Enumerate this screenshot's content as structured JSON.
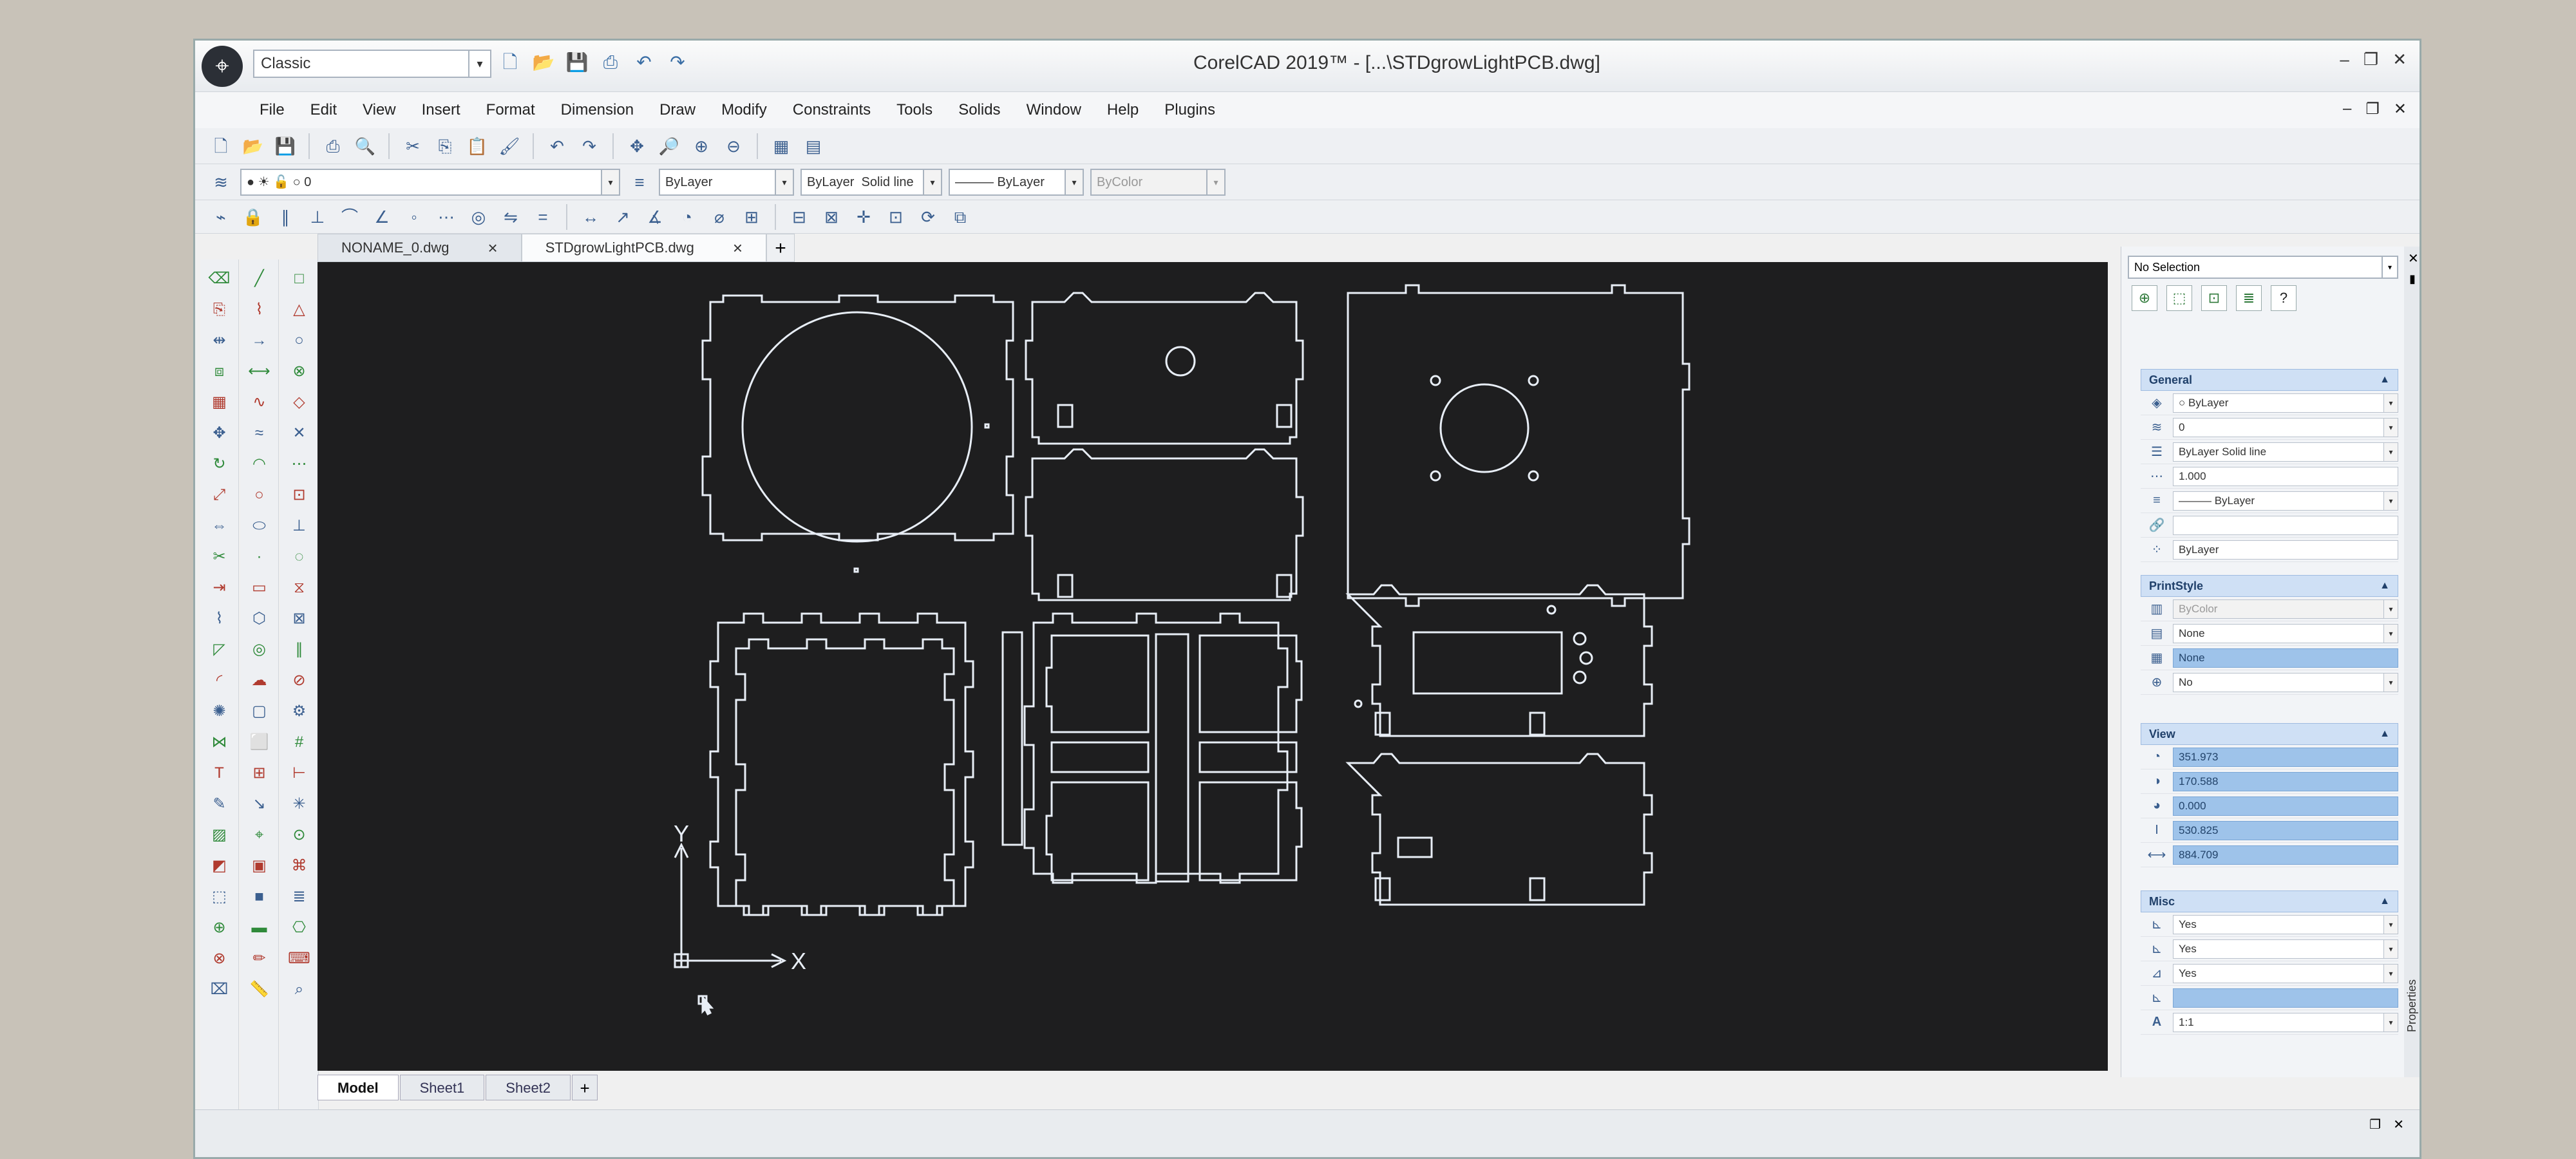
{
  "app": {
    "title": "CorelCAD 2019™ - [...\\STDgrowLightPCB.dwg]",
    "workspace": "Classic"
  },
  "menu": [
    "File",
    "Edit",
    "View",
    "Insert",
    "Format",
    "Dimension",
    "Draw",
    "Modify",
    "Constraints",
    "Tools",
    "Solids",
    "Window",
    "Help",
    "Plugins"
  ],
  "layer_toolbar": {
    "layer_value": "0",
    "color_value": "ByLayer",
    "linestyle_value": "ByLayer",
    "linestyle_type": "Solid line",
    "lineweight_value": "——— ByLayer",
    "printstyle_value": "ByColor"
  },
  "doc_tabs": [
    "NONAME_0.dwg",
    "STDgrowLightPCB.dwg"
  ],
  "layout_tabs": [
    "Model",
    "Sheet1",
    "Sheet2"
  ],
  "ucs": {
    "x_label": "X",
    "y_label": "Y"
  },
  "properties": {
    "selection": "No Selection",
    "general": {
      "title": "General",
      "rows": [
        "ByLayer",
        "0",
        "ByLayer    Solid line",
        "1.000",
        "——— ByLayer",
        "",
        "ByLayer"
      ]
    },
    "printstyle": {
      "title": "PrintStyle",
      "rows": [
        "ByColor",
        "None",
        "None",
        "No"
      ]
    },
    "view": {
      "title": "View",
      "rows": [
        "351.973",
        "170.588",
        "0.000",
        "530.825",
        "884.709"
      ]
    },
    "misc": {
      "title": "Misc",
      "rows": [
        "Yes",
        "Yes",
        "Yes",
        "",
        "1:1"
      ]
    },
    "side_label": "Properties"
  },
  "icons": {
    "app_logo": "corelcad-logo-icon",
    "new": "new-file-icon",
    "open": "open-folder-icon",
    "save": "save-icon",
    "print": "print-icon"
  }
}
